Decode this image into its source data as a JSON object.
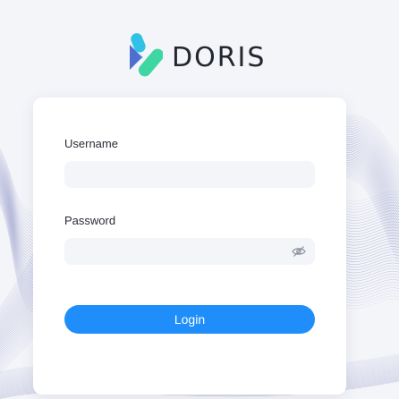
{
  "brand": {
    "name": "DORIS",
    "logo_icon": "doris-logo-icon"
  },
  "login_form": {
    "username": {
      "label": "Username",
      "value": "",
      "placeholder": ""
    },
    "password": {
      "label": "Password",
      "value": "",
      "placeholder": "",
      "toggle_icon": "eye-slash-icon"
    },
    "submit_label": "Login"
  },
  "colors": {
    "accent": "#1f8efa",
    "logo_blue": "#4f6fd0",
    "logo_cyan": "#2fc2e6",
    "logo_green": "#3fd6a4",
    "background": "#f4f5f9",
    "card": "#ffffff",
    "input_bg": "#f3f5f9"
  }
}
